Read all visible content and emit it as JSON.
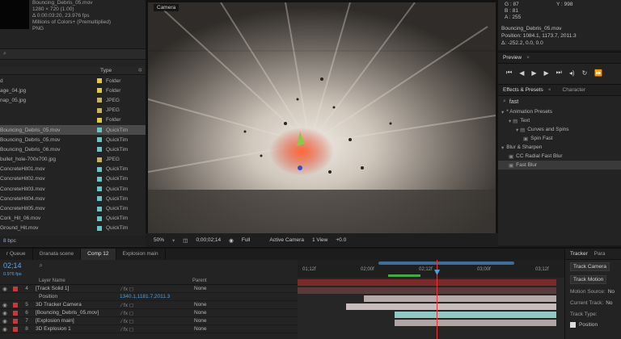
{
  "project": {
    "info_lines": [
      "Bouncing_Debris_05.mov",
      "1280 × 720 (1.00)",
      "Δ 0:00:03:20, 23.976 fps",
      "Millions of Colors+ (Premultiplied)",
      "PNG"
    ],
    "header": {
      "type": "Type"
    },
    "items": [
      {
        "name": "d",
        "type": "Folder",
        "color": "#e0c84a",
        "selected": false
      },
      {
        "name": "age_04.jpg",
        "type": "Folder",
        "color": "#e0c84a",
        "selected": false
      },
      {
        "name": "nap_05.jpg",
        "type": "JPEG",
        "color": "#c9b25a",
        "selected": false
      },
      {
        "name": "",
        "type": "JPEG",
        "color": "#c9b25a",
        "selected": false
      },
      {
        "name": "",
        "type": "Folder",
        "color": "#e0c84a",
        "selected": false
      },
      {
        "name": "Bouncing_Debris_05.mov",
        "type": "QuickTim",
        "color": "#6ac6c6",
        "selected": true
      },
      {
        "name": "Bouncing_Debris_05.mov",
        "type": "QuickTim",
        "color": "#6ac6c6",
        "selected": false
      },
      {
        "name": "Bouncing_Debris_06.mov",
        "type": "QuickTim",
        "color": "#6ac6c6",
        "selected": false
      },
      {
        "name": "bullet_hole-700x700.jpg",
        "type": "JPEG",
        "color": "#c9b25a",
        "selected": false
      },
      {
        "name": "ConcreteHit01.mov",
        "type": "QuickTim",
        "color": "#6ac6c6",
        "selected": false
      },
      {
        "name": "ConcreteHit02.mov",
        "type": "QuickTim",
        "color": "#6ac6c6",
        "selected": false
      },
      {
        "name": "ConcreteHit03.mov",
        "type": "QuickTim",
        "color": "#6ac6c6",
        "selected": false
      },
      {
        "name": "ConcreteHit04.mov",
        "type": "QuickTim",
        "color": "#6ac6c6",
        "selected": false
      },
      {
        "name": "ConcreteHit05.mov",
        "type": "QuickTim",
        "color": "#6ac6c6",
        "selected": false
      },
      {
        "name": "Cork_Hit_06.mov",
        "type": "QuickTim",
        "color": "#6ac6c6",
        "selected": false
      },
      {
        "name": "Ground_Hit.mov",
        "type": "QuickTim",
        "color": "#6ac6c6",
        "selected": false
      }
    ],
    "footer_bpc": "8 bpc"
  },
  "viewer": {
    "tab": "Camera",
    "zoom": "50%",
    "timecode": "0;00;02;14",
    "resolution": "Full",
    "camera": "Active Camera",
    "views": "1 View",
    "offset": "+0.0"
  },
  "info": {
    "g_label": "G : 87",
    "b_label": "B : 81",
    "a_label": "A : 255",
    "y_label": "Y : 998",
    "line1": "Bouncing_Debris_05.mov",
    "line2": "Position: 1084.1, 1173.7, 2011.3",
    "line3": "Δ: -252.2, 0.0, 0.0"
  },
  "preview": {
    "tab": "Preview"
  },
  "effects": {
    "tab_active": "Effects & Presets",
    "tab_other": "Character",
    "search_value": "fast",
    "tree": [
      {
        "label": "* Animation Presets",
        "indent": 0,
        "highlight": false
      },
      {
        "label": "Text",
        "indent": 1,
        "highlight": false
      },
      {
        "label": "Curves and Spins",
        "indent": 2,
        "highlight": false
      },
      {
        "label": "Spin Fast",
        "indent": 3,
        "highlight": false
      },
      {
        "label": "Blur & Sharpen",
        "indent": 0,
        "highlight": false
      },
      {
        "label": "CC Radial Fast Blur",
        "indent": 1,
        "highlight": false
      },
      {
        "label": "Fast Blur",
        "indent": 1,
        "highlight": true
      }
    ]
  },
  "timeline": {
    "tabs": [
      {
        "label": "r Queue",
        "active": false
      },
      {
        "label": "Granata scene",
        "active": false
      },
      {
        "label": "Comp 12",
        "active": true
      },
      {
        "label": "Explosion main",
        "active": false
      }
    ],
    "timecode": "02;14",
    "fps": "0.976 fps",
    "col_layer_name": "Layer Name",
    "col_parent": "Parent",
    "position_label": "Position",
    "position_value": "1340.1,1181.7,2011.3",
    "ruler_labels": [
      "01;12f",
      "02;00f",
      "02;12f",
      "03;00f",
      "03;12f"
    ],
    "layers": [
      {
        "num": "4",
        "name": "[Track Solid 1]",
        "parent": "None",
        "color": "#c43a3a"
      },
      {
        "num": "5",
        "name": "3D Tracker Camera",
        "parent": "None",
        "color": "#c43a3a"
      },
      {
        "num": "6",
        "name": "[Bouncing_Debris_05.mov]",
        "parent": "None",
        "color": "#c43a3a"
      },
      {
        "num": "7",
        "name": "[Explosion main]",
        "parent": "None",
        "color": "#c43a3a"
      },
      {
        "num": "8",
        "name": "3D Explosion 1",
        "parent": "None",
        "color": "#c43a3a"
      }
    ]
  },
  "tracker": {
    "tab": "Tracker",
    "tab2": "Para",
    "track_camera": "Track Camera",
    "track_motion": "Track Motion",
    "motion_source_label": "Motion Source:",
    "motion_source_value": "No",
    "current_track_label": "Current Track:",
    "current_track_value": "No",
    "track_type_label": "Track Type:",
    "position_label": "Position"
  }
}
